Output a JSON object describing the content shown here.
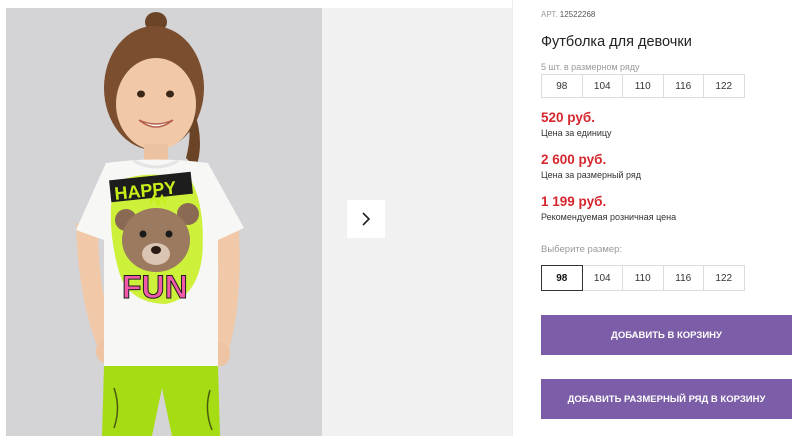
{
  "product": {
    "sku_label": "АРТ.",
    "sku": "12522268",
    "title": "Футболка для девочки"
  },
  "pack": {
    "note": "5 шт. в размерном ряду",
    "sizes": [
      "98",
      "104",
      "110",
      "116",
      "122"
    ]
  },
  "prices": [
    {
      "value": "520 руб.",
      "label": "Цена за единицу"
    },
    {
      "value": "2 600 руб.",
      "label": "Цена за размерный ряд"
    },
    {
      "value": "1 199 руб.",
      "label": "Рекомендуемая розничная цена"
    }
  ],
  "size_picker": {
    "label": "Выберите размер:",
    "sizes": [
      "98",
      "104",
      "110",
      "116",
      "122"
    ],
    "selected": "98"
  },
  "actions": {
    "add_to_cart": "ДОБАВИТЬ В КОРЗИНУ",
    "add_pack_to_cart": "ДОБАВИТЬ РАЗМЕРНЫЙ РЯД В КОРЗИНУ"
  },
  "gallery": {
    "print_text_top": "HAPPY",
    "print_text_bottom": "FUN",
    "next_icon": "chevron-right-icon"
  },
  "colors": {
    "price": "#d6262e",
    "button": "#7b5ea7",
    "print_neon": "#c6ef1a",
    "print_pink": "#f05aa8"
  }
}
